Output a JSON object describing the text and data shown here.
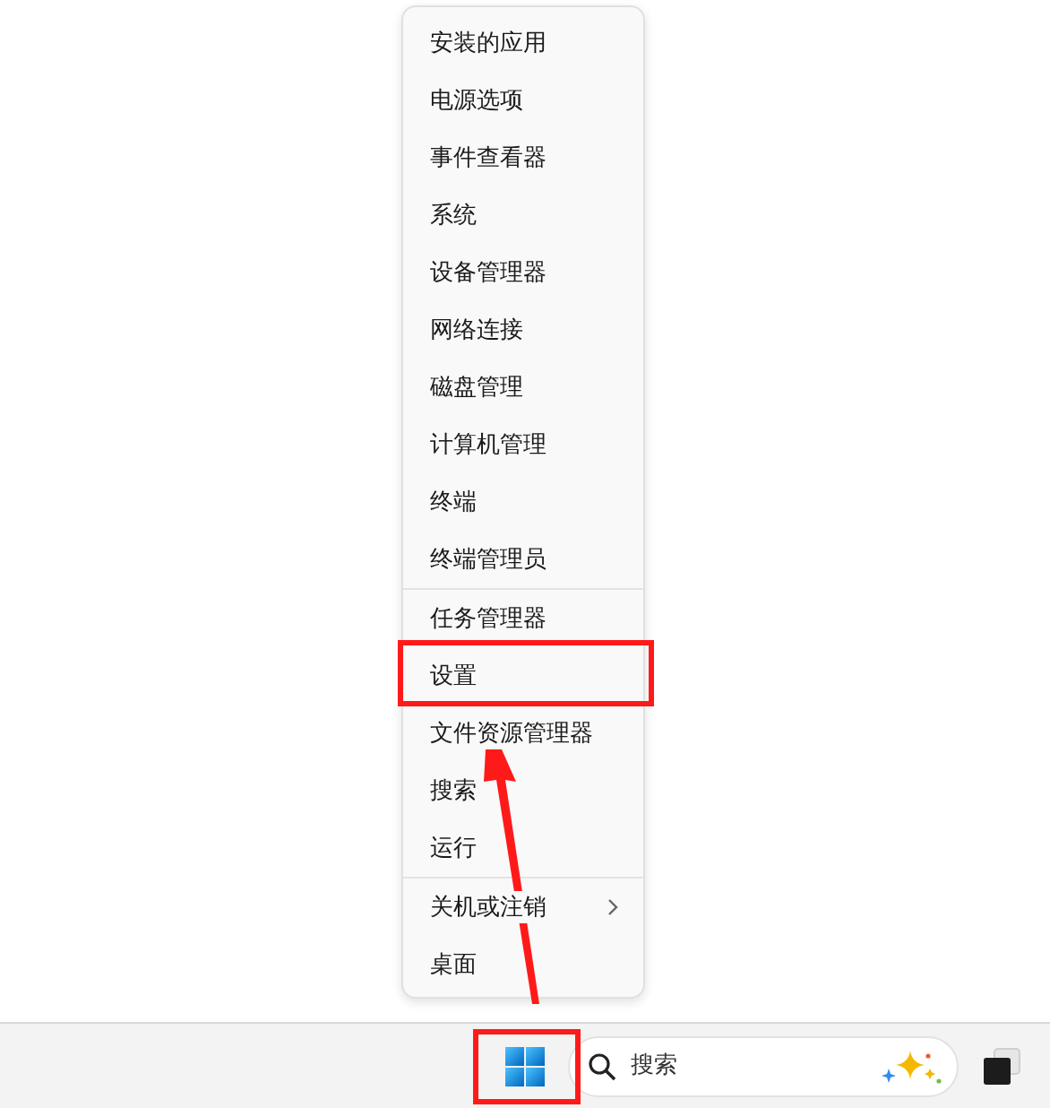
{
  "start_menu": {
    "groups": [
      {
        "items": [
          {
            "label": "安装的应用",
            "submenu": false
          },
          {
            "label": "电源选项",
            "submenu": false
          },
          {
            "label": "事件查看器",
            "submenu": false
          },
          {
            "label": "系统",
            "submenu": false
          },
          {
            "label": "设备管理器",
            "submenu": false
          },
          {
            "label": "网络连接",
            "submenu": false
          },
          {
            "label": "磁盘管理",
            "submenu": false
          },
          {
            "label": "计算机管理",
            "submenu": false
          },
          {
            "label": "终端",
            "submenu": false
          },
          {
            "label": "终端管理员",
            "submenu": false
          }
        ]
      },
      {
        "items": [
          {
            "label": "任务管理器",
            "submenu": false
          },
          {
            "label": "设置",
            "submenu": false
          },
          {
            "label": "文件资源管理器",
            "submenu": false
          },
          {
            "label": "搜索",
            "submenu": false
          },
          {
            "label": "运行",
            "submenu": false
          }
        ]
      },
      {
        "items": [
          {
            "label": "关机或注销",
            "submenu": true
          },
          {
            "label": "桌面",
            "submenu": false
          }
        ]
      }
    ]
  },
  "taskbar": {
    "search": {
      "placeholder": "搜索"
    }
  }
}
